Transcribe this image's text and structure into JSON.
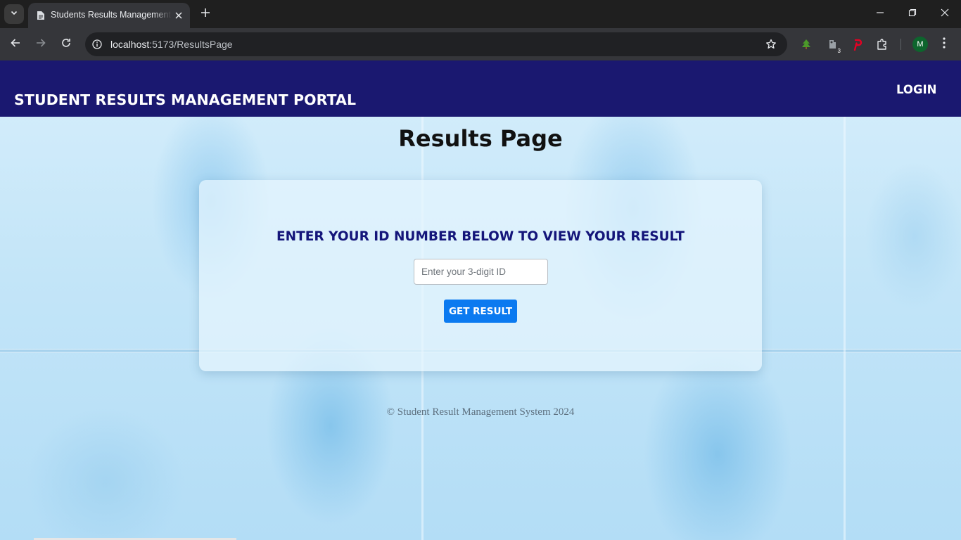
{
  "browser": {
    "tab": {
      "title": "Students Results Management Portal"
    },
    "address_bar": {
      "host": "localhost",
      "path": ":5173/ResultsPage"
    },
    "extensions": [
      {
        "name": "tree-extension-icon",
        "color": "#3c8a2e"
      },
      {
        "name": "puzzle-key-extension-icon",
        "badge": "3"
      },
      {
        "name": "pinterest-extension-icon",
        "color": "#e60023"
      },
      {
        "name": "extensions-puzzle-icon"
      }
    ],
    "profile_initial": "M"
  },
  "navbar": {
    "brand": "STUDENT RESULTS MANAGEMENT PORTAL",
    "login_label": "LOGIN",
    "background": "#1a1870"
  },
  "page": {
    "title": "Results Page",
    "card": {
      "heading": "ENTER YOUR ID NUMBER BELOW TO VIEW YOUR RESULT",
      "id_input": {
        "value": "",
        "placeholder": "Enter your 3-digit ID"
      },
      "submit_label": "GET RESULT",
      "accent": "#0b7af0"
    },
    "footer": "© Student Result Management System 2024"
  }
}
